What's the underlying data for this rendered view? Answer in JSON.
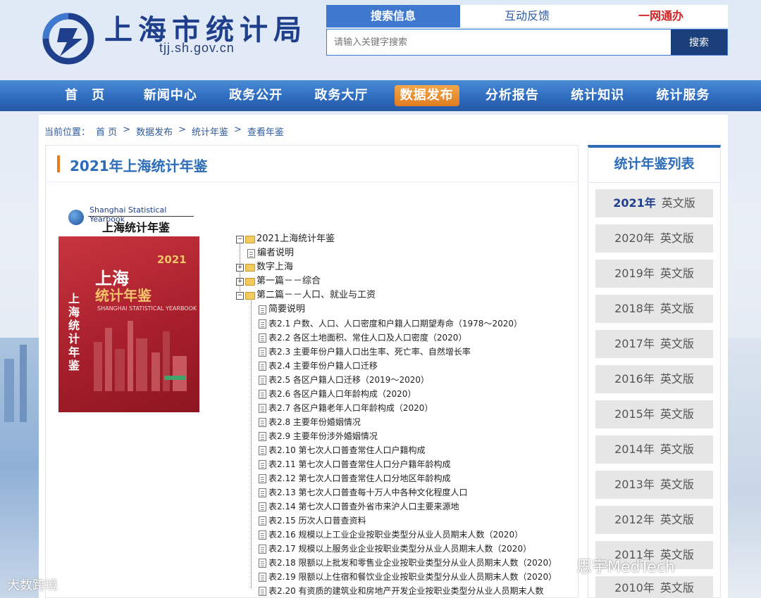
{
  "header": {
    "site_title": "上海市统计局",
    "site_domain": "tjj.sh.gov.cn",
    "top_tabs": [
      "搜索信息",
      "互动反馈",
      "一网通办"
    ],
    "search_placeholder": "请输入关键字搜索",
    "search_button": "搜索"
  },
  "nav": {
    "items": [
      "首　页",
      "新闻中心",
      "政务公开",
      "政务大厅",
      "数据发布",
      "分析报告",
      "统计知识",
      "统计服务"
    ],
    "active_index": 4
  },
  "breadcrumb": {
    "label": "当前位置：",
    "items": [
      "首 页",
      "数据发布",
      "统计年鉴",
      "查看年鉴"
    ],
    "sep": ">"
  },
  "main": {
    "title": "2021年上海统计年鉴",
    "cover": {
      "en_title": "Shanghai Statistical Yearbook",
      "cn_title": "上海统计年鉴",
      "year": "2021",
      "big1": "上海",
      "big2": "统计年鉴",
      "sub": "SHANGHAI STATISTICAL YEARBOOK",
      "vertical": "上海统计年鉴"
    },
    "tree": {
      "root": "2021上海统计年鉴",
      "items": [
        {
          "label": "编者说明",
          "type": "doc",
          "level": 1
        },
        {
          "label": "数字上海",
          "type": "folder",
          "level": 1,
          "expanded": false
        },
        {
          "label": "第一篇－－综合",
          "type": "folder",
          "level": 1,
          "expanded": false
        },
        {
          "label": "第二篇－－人口、就业与工资",
          "type": "folder",
          "level": 1,
          "expanded": true
        },
        {
          "label": "简要说明",
          "type": "doc",
          "level": 2
        },
        {
          "label": "表2.1 户数、人口、人口密度和户籍人口期望寿命（1978～2020）",
          "type": "doc",
          "level": 2
        },
        {
          "label": "表2.2 各区土地面积、常住人口及人口密度（2020）",
          "type": "doc",
          "level": 2
        },
        {
          "label": "表2.3 主要年份户籍人口出生率、死亡率、自然增长率",
          "type": "doc",
          "level": 2
        },
        {
          "label": "表2.4 主要年份户籍人口迁移",
          "type": "doc",
          "level": 2
        },
        {
          "label": "表2.5 各区户籍人口迁移（2019～2020）",
          "type": "doc",
          "level": 2
        },
        {
          "label": "表2.6 各区户籍人口年龄构成（2020）",
          "type": "doc",
          "level": 2
        },
        {
          "label": "表2.7 各区户籍老年人口年龄构成（2020）",
          "type": "doc",
          "level": 2
        },
        {
          "label": "表2.8 主要年份婚姻情况",
          "type": "doc",
          "level": 2
        },
        {
          "label": "表2.9 主要年份涉外婚姻情况",
          "type": "doc",
          "level": 2
        },
        {
          "label": "表2.10 第七次人口普查常住人口户籍构成",
          "type": "doc",
          "level": 2
        },
        {
          "label": "表2.11 第七次人口普查常住人口分户籍年龄构成",
          "type": "doc",
          "level": 2
        },
        {
          "label": "表2.12 第七次人口普查常住人口分地区年龄构成",
          "type": "doc",
          "level": 2
        },
        {
          "label": "表2.13 第七次人口普查每十万人中各种文化程度人口",
          "type": "doc",
          "level": 2
        },
        {
          "label": "表2.14 第七次人口普查外省市来沪人口主要来源地",
          "type": "doc",
          "level": 2
        },
        {
          "label": "表2.15 历次人口普查资料",
          "type": "doc",
          "level": 2
        },
        {
          "label": "表2.16 规模以上工业企业按职业类型分从业人员期末人数（2020）",
          "type": "doc",
          "level": 2
        },
        {
          "label": "表2.17 规模以上服务业企业按职业类型分从业人员期末人数（2020）",
          "type": "doc",
          "level": 2
        },
        {
          "label": "表2.18 限额以上批发和零售业企业按职业类型分从业人员期末人数（2020）",
          "type": "doc",
          "level": 2
        },
        {
          "label": "表2.19 限额以上住宿和餐饮业企业按职业类型分从业人员期末人数（2020）",
          "type": "doc",
          "level": 2
        },
        {
          "label": "表2.20 有资质的建筑业和房地产开发企业按职业类型分从业人员期末人数",
          "type": "doc",
          "level": 2
        }
      ]
    }
  },
  "sidebar": {
    "title": "统计年鉴列表",
    "years": [
      {
        "year": "2021年",
        "lang": "英文版",
        "active": true
      },
      {
        "year": "2020年",
        "lang": "英文版"
      },
      {
        "year": "2019年",
        "lang": "英文版"
      },
      {
        "year": "2018年",
        "lang": "英文版"
      },
      {
        "year": "2017年",
        "lang": "英文版"
      },
      {
        "year": "2016年",
        "lang": "英文版"
      },
      {
        "year": "2015年",
        "lang": "英文版"
      },
      {
        "year": "2014年",
        "lang": "英文版"
      },
      {
        "year": "2013年",
        "lang": "英文版"
      },
      {
        "year": "2012年",
        "lang": "英文版"
      },
      {
        "year": "2011年",
        "lang": "英文版"
      },
      {
        "year": "2010年",
        "lang": "英文版"
      }
    ]
  },
  "watermarks": {
    "left": "大数跨境",
    "right": "思宇MedTech"
  }
}
